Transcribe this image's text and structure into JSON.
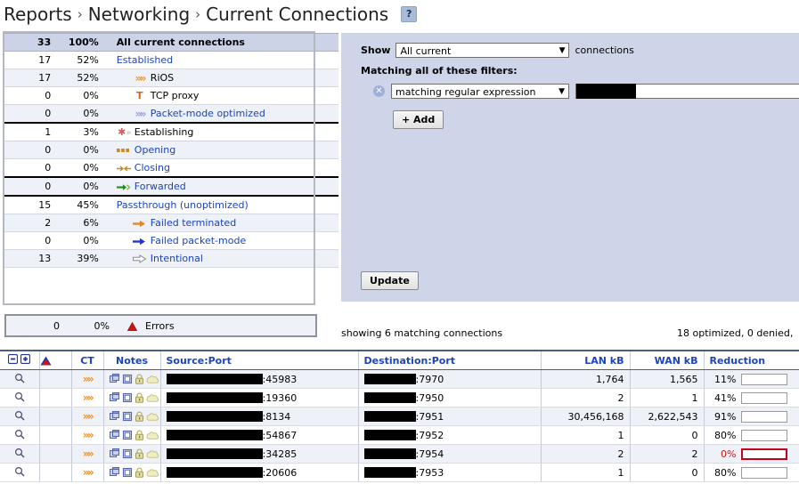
{
  "breadcrumb": {
    "items": [
      "Reports",
      "Networking",
      "Current Connections"
    ],
    "separator": "›",
    "help_label": "?"
  },
  "summary": {
    "header": {
      "count": "33",
      "pct": "100%",
      "label": "All current connections"
    },
    "rows": [
      {
        "count": "17",
        "pct": "52%",
        "label": "Established",
        "icon": "",
        "link": true,
        "indent": 0
      },
      {
        "count": "17",
        "pct": "52%",
        "label": "RiOS",
        "icon": "chevrons-orange-icon",
        "link": false,
        "indent": 1
      },
      {
        "count": "0",
        "pct": "0%",
        "label": "TCP proxy",
        "icon": "t-letter-icon",
        "link": false,
        "indent": 1
      },
      {
        "count": "0",
        "pct": "0%",
        "label": "Packet-mode optimized",
        "icon": "chevrons-blue-icon",
        "link": true,
        "indent": 1
      },
      {
        "count": "1",
        "pct": "3%",
        "label": "Establishing",
        "icon": "asterisk-arrow-icon",
        "link": false,
        "indent": 0,
        "rule": "top"
      },
      {
        "count": "0",
        "pct": "0%",
        "label": "Opening",
        "icon": "dots-icon",
        "link": true,
        "indent": 0
      },
      {
        "count": "0",
        "pct": "0%",
        "label": "Closing",
        "icon": "two-arrows-icon",
        "link": true,
        "indent": 0
      },
      {
        "count": "0",
        "pct": "0%",
        "label": "Forwarded",
        "icon": "arrow-green-icon",
        "link": true,
        "indent": 0,
        "rule": "top"
      },
      {
        "count": "15",
        "pct": "45%",
        "label": "Passthrough (unoptimized)",
        "icon": "",
        "link": true,
        "indent": 0,
        "rule": "top"
      },
      {
        "count": "2",
        "pct": "6%",
        "label": "Failed terminated",
        "icon": "arrow-orange-icon",
        "link": true,
        "indent": 1
      },
      {
        "count": "0",
        "pct": "0%",
        "label": "Failed packet-mode",
        "icon": "arrow-blue-icon",
        "link": true,
        "indent": 1
      },
      {
        "count": "13",
        "pct": "39%",
        "label": "Intentional",
        "icon": "arrow-hollow-icon",
        "link": true,
        "indent": 1
      }
    ],
    "errors_row": {
      "count": "0",
      "pct": "0%",
      "label": "Errors",
      "icon": "warning-triangle-icon"
    }
  },
  "filters": {
    "show_label": "Show",
    "show_value": "All current",
    "show_suffix": "connections",
    "matching_label": "Matching all of these filters:",
    "filter_type_value": "matching regular expression",
    "filter_value": "",
    "add_label": "+ Add",
    "update_label": "Update",
    "remove_icon": "remove-filter-icon"
  },
  "status": {
    "showing": "showing 6 matching connections",
    "counters": "18 optimized, 0 denied,"
  },
  "connections": {
    "columns": [
      {
        "key": "actions",
        "label": "",
        "icon": "expand-collapse-icon"
      },
      {
        "key": "alert",
        "label": "",
        "icon": "warning-triangle-icon"
      },
      {
        "key": "ct",
        "label": "CT",
        "icon": ""
      },
      {
        "key": "notes",
        "label": "Notes",
        "icon": ""
      },
      {
        "key": "source",
        "label": "Source:Port",
        "icon": ""
      },
      {
        "key": "dest",
        "label": "Destination:Port",
        "icon": ""
      },
      {
        "key": "lan",
        "label": "LAN kB",
        "icon": ""
      },
      {
        "key": "wan",
        "label": "WAN kB",
        "icon": ""
      },
      {
        "key": "reduction",
        "label": "Reduction",
        "icon": ""
      }
    ],
    "rows": [
      {
        "source_ip": "",
        "source_port": ":45983",
        "dest_ip": "",
        "dest_port": ":7970",
        "lan": "1,764",
        "wan": "1,565",
        "reduction": "11%",
        "reduction_value": 11,
        "zero": false
      },
      {
        "source_ip": "",
        "source_port": ":19360",
        "dest_ip": "",
        "dest_port": ":7950",
        "lan": "2",
        "wan": "1",
        "reduction": "41%",
        "reduction_value": 41,
        "zero": false
      },
      {
        "source_ip": "",
        "source_port": ":8134",
        "dest_ip": "",
        "dest_port": ":7951",
        "lan": "30,456,168",
        "wan": "2,622,543",
        "reduction": "91%",
        "reduction_value": 91,
        "zero": false
      },
      {
        "source_ip": "",
        "source_port": ":54867",
        "dest_ip": "",
        "dest_port": ":7952",
        "lan": "1",
        "wan": "0",
        "reduction": "80%",
        "reduction_value": 80,
        "zero": false
      },
      {
        "source_ip": "",
        "source_port": ":34285",
        "dest_ip": "",
        "dest_port": ":7954",
        "lan": "2",
        "wan": "2",
        "reduction": "0%",
        "reduction_value": 0,
        "zero": true
      },
      {
        "source_ip": "",
        "source_port": ":20606",
        "dest_ip": "",
        "dest_port": ":7953",
        "lan": "1",
        "wan": "0",
        "reduction": "80%",
        "reduction_value": 80,
        "zero": false
      }
    ],
    "note_icons": [
      "windows-icon",
      "window-icon",
      "lock-icon",
      "cloud-icon"
    ],
    "ct_icon": "chevrons-orange-icon",
    "magnifier_icon": "magnifier-icon"
  },
  "colors": {
    "link": "#1b44bd",
    "panel": "#ced5e9",
    "header_row": "#ccd3e8",
    "alt_row": "#eef1f7",
    "bar_fill": "#d4a02e",
    "zero_border": "#c2001a",
    "orange": "#f08a1e",
    "green": "#1f8a1f",
    "red": "#cc1111"
  }
}
